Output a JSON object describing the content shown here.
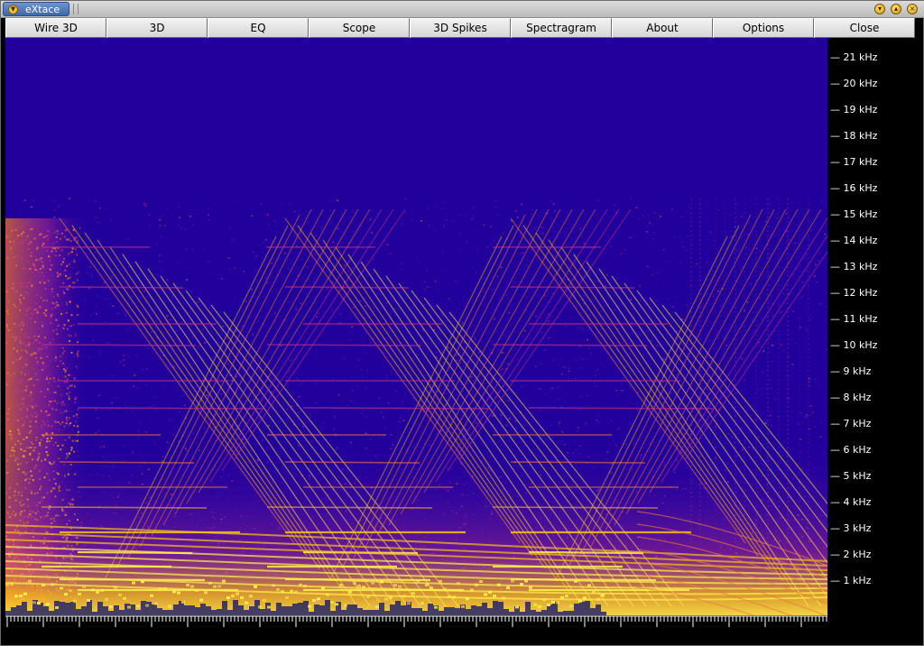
{
  "window": {
    "title": "eXtace",
    "menu_icon": "down-arrow-icon",
    "controls": [
      {
        "name": "minimize",
        "icon": "minimize-icon",
        "glyph": "▾"
      },
      {
        "name": "maximize",
        "icon": "maximize-icon",
        "glyph": "▴"
      },
      {
        "name": "close",
        "icon": "close-icon",
        "glyph": "×"
      }
    ]
  },
  "toolbar": {
    "buttons": [
      {
        "label": "Wire 3D"
      },
      {
        "label": "3D"
      },
      {
        "label": "EQ"
      },
      {
        "label": "Scope"
      },
      {
        "label": "3D Spikes"
      },
      {
        "label": "Spectragram"
      },
      {
        "label": "About"
      },
      {
        "label": "Options"
      },
      {
        "label": "Close"
      }
    ]
  },
  "spectrogram": {
    "background_color": "#22009c",
    "colormap": [
      "#22009c",
      "#6a1aa0",
      "#c8368a",
      "#ee7a3a",
      "#f6c21a",
      "#fff050"
    ],
    "max_frequency_khz": 22,
    "frequency_labels": [
      "21 kHz",
      "20 kHz",
      "19 kHz",
      "18 kHz",
      "17 kHz",
      "16 kHz",
      "15 kHz",
      "14 kHz",
      "13 kHz",
      "12 kHz",
      "11 kHz",
      "10 kHz",
      "9 kHz",
      "8 kHz",
      "7 kHz",
      "6 kHz",
      "5 kHz",
      "4 kHz",
      "3 kHz",
      "2 kHz",
      "1 kHz"
    ],
    "axis_color": "#ffffff"
  }
}
